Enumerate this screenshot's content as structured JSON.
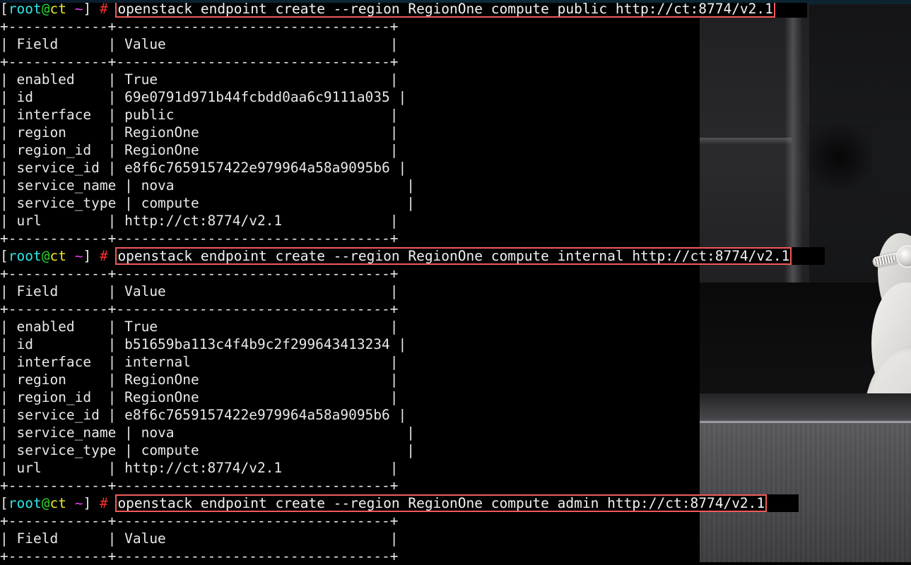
{
  "terminal": {
    "prompt": {
      "open_bracket": "[",
      "user": "root",
      "at": "@",
      "host": "ct",
      "path": " ~",
      "close_bracket": "]",
      "sigil": "#"
    },
    "colors": {
      "background": "#000000",
      "foreground": "#e8e8e8",
      "user": "#2ee6e6",
      "at": "#25d825",
      "host": "#e8e82a",
      "path": "#e83fe8",
      "sigil": "#f03030",
      "highlight_box": "#f05a5a"
    },
    "rule_top": "+------------+---------------------------------+",
    "commands": [
      "openstack endpoint create --region RegionOne compute public http://ct:8774/v2.1",
      "openstack endpoint create --region RegionOne compute internal http://ct:8774/v2.1",
      "openstack endpoint create --region RegionOne compute admin http://ct:8774/v2.1"
    ],
    "table_headers": {
      "field": "Field",
      "value": "Value"
    },
    "tables": [
      {
        "rows": [
          {
            "field": "enabled",
            "value": "True"
          },
          {
            "field": "id",
            "value": "69e0791d971b44fcbdd0aa6c9111a035"
          },
          {
            "field": "interface",
            "value": "public"
          },
          {
            "field": "region",
            "value": "RegionOne"
          },
          {
            "field": "region_id",
            "value": "RegionOne"
          },
          {
            "field": "service_id",
            "value": "e8f6c7659157422e979964a58a9095b6"
          },
          {
            "field": "service_name",
            "value": "nova"
          },
          {
            "field": "service_type",
            "value": "compute"
          },
          {
            "field": "url",
            "value": "http://ct:8774/v2.1"
          }
        ]
      },
      {
        "rows": [
          {
            "field": "enabled",
            "value": "True"
          },
          {
            "field": "id",
            "value": "b51659ba113c4f4b9c2f299643413234"
          },
          {
            "field": "interface",
            "value": "internal"
          },
          {
            "field": "region",
            "value": "RegionOne"
          },
          {
            "field": "region_id",
            "value": "RegionOne"
          },
          {
            "field": "service_id",
            "value": "e8f6c7659157422e979964a58a9095b6"
          },
          {
            "field": "service_name",
            "value": "nova"
          },
          {
            "field": "service_type",
            "value": "compute"
          },
          {
            "field": "url",
            "value": "http://ct:8774/v2.1"
          }
        ]
      },
      {
        "rows": []
      }
    ]
  }
}
